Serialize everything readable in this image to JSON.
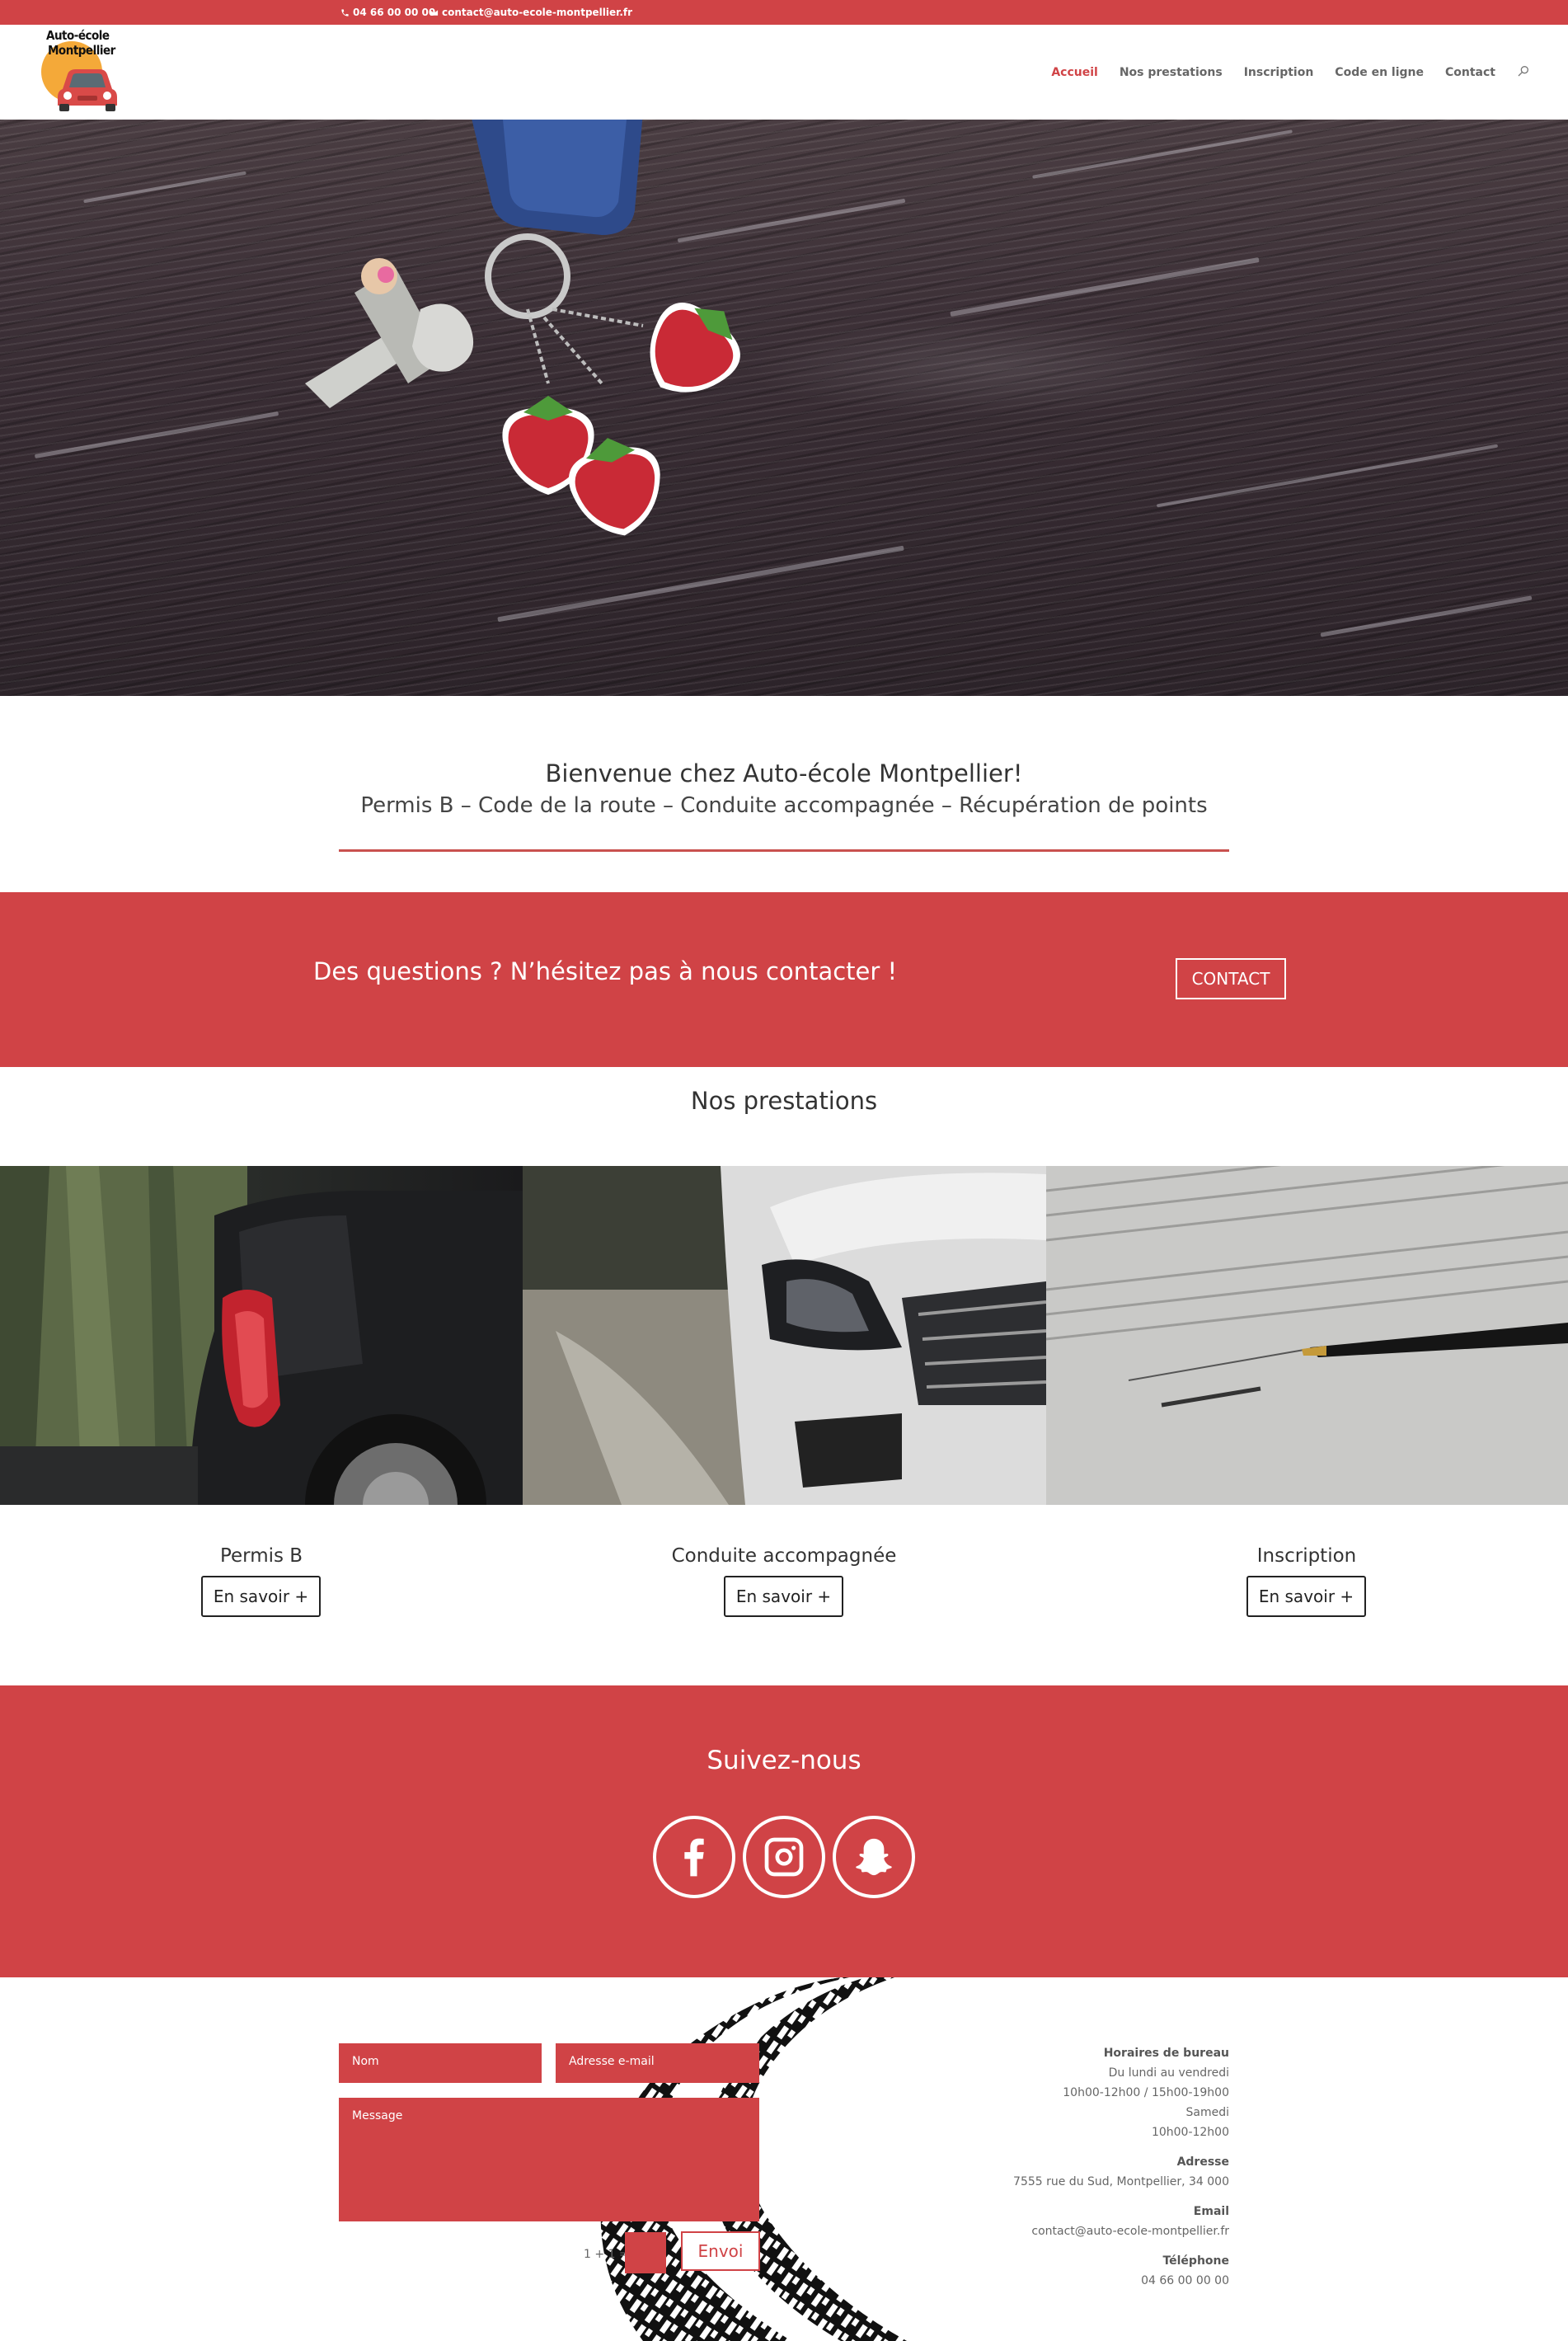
{
  "topbar": {
    "phone": "04 66 00 00 00",
    "email": "contact@auto-ecole-montpellier.fr"
  },
  "logo": {
    "line1": "Auto-école",
    "line2": "Montpellier"
  },
  "nav": {
    "items": [
      {
        "label": "Accueil",
        "active": true
      },
      {
        "label": "Nos prestations",
        "active": false
      },
      {
        "label": "Inscription",
        "active": false
      },
      {
        "label": "Code en ligne",
        "active": false
      },
      {
        "label": "Contact",
        "active": false
      }
    ],
    "search_icon": "search-icon"
  },
  "hero": {
    "slides": 3,
    "active_slide": 3
  },
  "welcome": {
    "title": "Bienvenue chez Auto-école Montpellier!",
    "subtitle": "Permis B – Code de la route – Conduite accompagnée – Récupération de points"
  },
  "cta": {
    "question": "Des questions ? N’hésitez pas à nous contacter !",
    "button": "CONTACT"
  },
  "prestations": {
    "title": "Nos prestations",
    "cards": [
      {
        "title": "Permis B",
        "button": "En savoir +"
      },
      {
        "title": "Conduite accompagnée",
        "button": "En savoir +"
      },
      {
        "title": "Inscription",
        "button": "En savoir +"
      }
    ]
  },
  "social": {
    "title": "Suivez-nous",
    "icons": [
      "facebook-icon",
      "instagram-icon",
      "snapchat-icon"
    ]
  },
  "form": {
    "name_placeholder": "Nom",
    "email_placeholder": "Adresse e-mail",
    "message_placeholder": "Message",
    "captcha": "1 + 1 =",
    "submit": "Envoi"
  },
  "info": {
    "hours_label": "Horaires de bureau",
    "hours_line1": "Du lundi au vendredi",
    "hours_line2": "10h00-12h00 / 15h00-19h00",
    "hours_line3": "Samedi",
    "hours_line4": "10h00-12h00",
    "address_label": "Adresse",
    "address": "7555 rue du Sud, Montpellier, 34 000",
    "email_label": "Email",
    "email": "contact@auto-ecole-montpellier.fr",
    "phone_label": "Téléphone",
    "phone": "04 66 00 00 00"
  },
  "colors": {
    "accent": "#d04346",
    "white": "#ffffff",
    "text": "#333333"
  }
}
